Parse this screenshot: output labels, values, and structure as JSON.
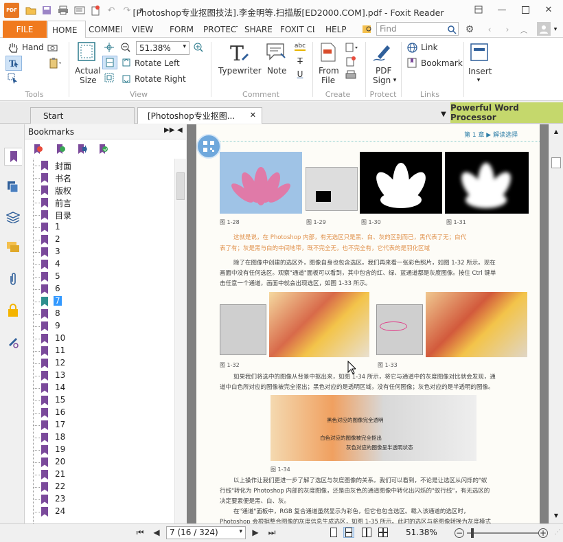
{
  "window": {
    "title": "[Photoshop专业抠图技法].李金明等.扫描版[ED2000.COM].pdf - Foxit Reader",
    "app_badge": "PDF"
  },
  "ribbon_tabs": {
    "file": "FILE",
    "items": [
      "HOME",
      "COMMENT",
      "VIEW",
      "FORM",
      "PROTECT",
      "SHARE",
      "FOXIT CLOUD",
      "HELP"
    ]
  },
  "search": {
    "placeholder": "Find"
  },
  "ribbon": {
    "hand": "Hand",
    "actual_size_1": "Actual",
    "actual_size_2": "Size",
    "zoom_value": "51.38%",
    "rotate_left": "Rotate Left",
    "rotate_right": "Rotate Right",
    "typewriter": "Typewriter",
    "note": "Note",
    "from_file_1": "From",
    "from_file_2": "File",
    "pdf_sign_1": "PDF",
    "pdf_sign_2": "Sign",
    "link": "Link",
    "bookmark": "Bookmark",
    "insert": "Insert",
    "groups": {
      "tools": "Tools",
      "view": "View",
      "comment": "Comment",
      "create": "Create",
      "protect": "Protect",
      "links": "Links"
    }
  },
  "doc_tabs": {
    "start": "Start",
    "current": "[Photoshop专业抠图...",
    "promo": "Powerful Word Processor"
  },
  "bookmarks": {
    "header": "Bookmarks",
    "items": [
      "封面",
      "书名",
      "版权",
      "前言",
      "目录",
      "1",
      "2",
      "3",
      "4",
      "5",
      "6",
      "7",
      "8",
      "9",
      "10",
      "11",
      "12",
      "13",
      "14",
      "15",
      "16",
      "17",
      "18",
      "19",
      "20",
      "21",
      "22",
      "23",
      "24"
    ],
    "selected": "7"
  },
  "page_content": {
    "header_right": "第 1 章 ▶ 解读选择",
    "fig_28": "图 1-28",
    "fig_29": "图 1-29",
    "fig_30": "图 1-30",
    "fig_31": "图 1-31",
    "quote_1": "这就是说，在 Photoshop 内部，有无选区只是黑、白、灰的区别而已，黑代表了无；白代",
    "quote_2": "表了有；灰是黑与白的中间地带，既不完全无，也不完全有，它代表的是羽化区域",
    "para1_1": "除了在图像中创建的选区外，图像自身也包含选区。我们再来看一张彩色照片，如图 1-32 所示。现在",
    "para1_2": "画面中没有任何选区。观察\"通道\"面板可以看到，其中包含的红、绿、蓝通道都是灰度图像。按住 Ctrl 键单",
    "para1_3": "击任意一个通道，画面中就会出现选区，如图 1-33 所示。",
    "fig_32": "图 1-32",
    "fig_33": "图 1-33",
    "para2_1": "如果我们将选中的图像从背景中抠出来，如图 1-34 所示，将它与通道中的灰度图像对比就会发现，通",
    "para2_2": "道中白色所对应的图像被完全抠出；黑色对应的是透明区域，没有任何图像；灰色对应的是半透明的图像。",
    "ann_1": "黑色对应的图像完全透明",
    "ann_2": "白色对应的图像被完全抠出",
    "ann_3": "灰色对应的图像呈半透明状态",
    "fig_34": "图 1-34",
    "para3_1": "以上操作让我们更进一步了解了选区与灰度图像的关系。我们可以看到，不论是让选区从闪烁的\"蚁",
    "para3_2": "行线\"转化为 Photoshop 内部的灰度图像，还是由灰色的通道图像中转化出闪烁的\"蚁行线\"，有无选区的",
    "para3_3": "决定要素便是黑、白、灰。",
    "para4_1": "在\"通道\"面板中，RGB 复合通道虽然显示为彩色，但它也包含选区。载入该通道的选区时，",
    "para4_2": "Photoshop 会根据整合图像的灰度信息生成选区，如图 1-35 所示。此时的选区与将图像转换为灰度模式"
  },
  "status": {
    "page_field": "7 (16 / 324)",
    "zoom": "51.38%"
  },
  "colors": {
    "accent": "#f07a1e",
    "bookmark": "#7b4a9b",
    "selection": "#3399ff",
    "promo": "#c5d86c"
  }
}
